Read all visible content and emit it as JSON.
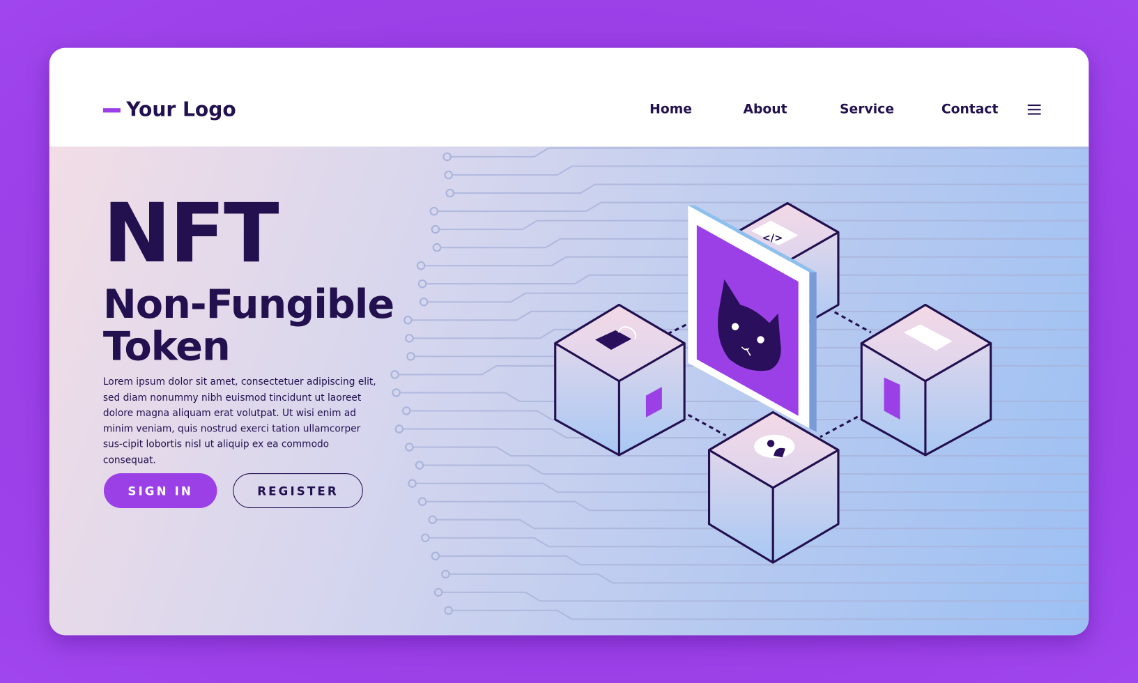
{
  "header": {
    "logo": "Your Logo",
    "nav": [
      "Home",
      "About",
      "Service",
      "Contact"
    ],
    "menu_icon": "hamburger-icon"
  },
  "hero": {
    "title": "NFT",
    "subtitle_line1": "Non-Fungible",
    "subtitle_line2": "Token",
    "paragraph": "Lorem ipsum dolor sit amet, consectetuer adipiscing elit, sed diam nonummy nibh euismod tincidunt ut laoreet dolore magna aliquam erat volutpat. Ut wisi enim ad minim veniam, quis nostrud exerci tation ullamcorper sus-cipit lobortis nisl ut aliquip ex ea commodo consequat.",
    "sign_in": "SIGN IN",
    "register": "REGISTER"
  },
  "illustration": {
    "icons": [
      "cat-nft-icon",
      "code-icon",
      "lock-icon",
      "phone-icon",
      "user-icon"
    ]
  },
  "colors": {
    "accent": "#9b40e6",
    "text": "#22104f",
    "background": "#9a3ee6"
  }
}
